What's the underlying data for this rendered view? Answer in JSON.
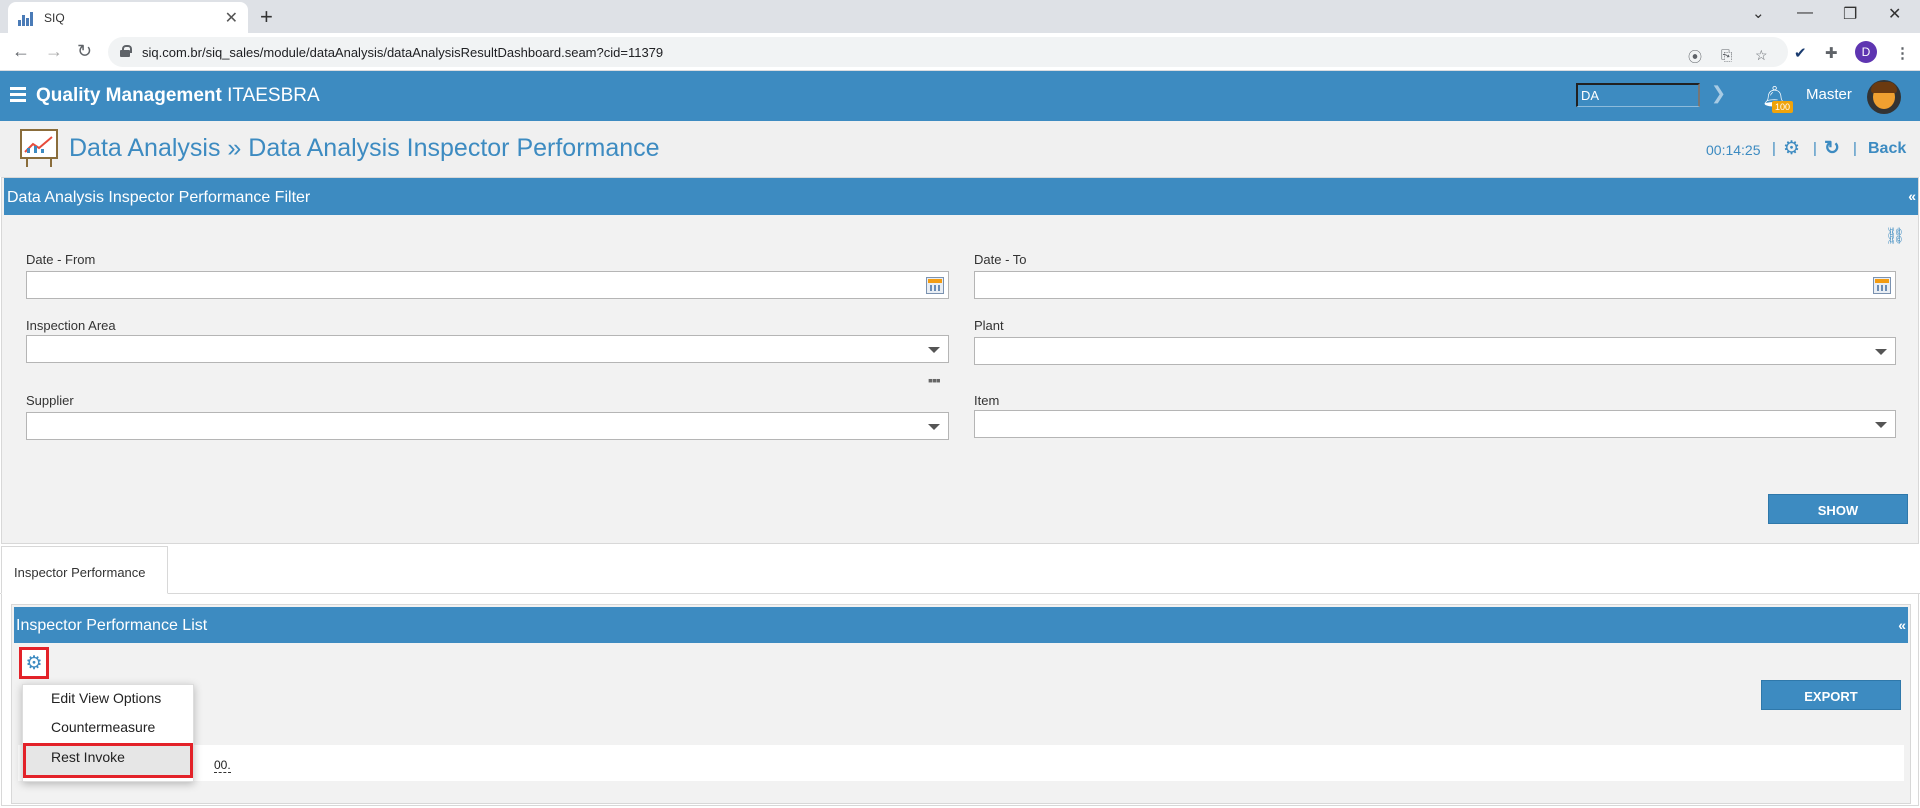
{
  "browser": {
    "tab_title": "SIQ",
    "tab_close": "✕",
    "new_tab": "+",
    "url": "siq.com.br/siq_sales/module/dataAnalysis/dataAnalysisResultDashboard.seam?cid=11379",
    "profile_initial": "D"
  },
  "header": {
    "title_bold": "Quality Management",
    "title_rest": "ITAESBRA",
    "search_value": "DA",
    "notification_count": "100",
    "user_name": "Master",
    "bg_color": "#3d8bc1"
  },
  "page": {
    "breadcrumb": "Data Analysis » Data Analysis Inspector Performance",
    "timer": "00:14:25",
    "separators": [
      "|",
      "|",
      "|"
    ],
    "back_label": "Back"
  },
  "filter": {
    "title": "Data Analysis Inspector Performance Filter",
    "collapse_symbol": "«",
    "fields": {
      "date_from": {
        "label": "Date - From",
        "value": ""
      },
      "date_to": {
        "label": "Date - To",
        "value": ""
      },
      "inspection_area": {
        "label": "Inspection Area",
        "value": ""
      },
      "plant": {
        "label": "Plant",
        "value": ""
      },
      "supplier": {
        "label": "Supplier",
        "value": ""
      },
      "item": {
        "label": "Item",
        "value": ""
      }
    },
    "more_symbol": "▪▪▪",
    "show_button": "SHOW"
  },
  "tabs": [
    {
      "label": "Inspector Performance",
      "active": true
    }
  ],
  "list": {
    "title": "Inspector Performance List",
    "collapse_symbol": "«",
    "export_button": "EXPORT",
    "menu_items": [
      "Edit View Options",
      "Countermeasure",
      "Rest Invoke"
    ],
    "highlighted_item": "Rest Invoke",
    "info_text_visible": "00."
  },
  "icons": {
    "gear": "gear-icon",
    "binoculars": "binoculars-icon",
    "calendar": "calendar-icon",
    "bell": "bell-icon",
    "refresh": "refresh-icon"
  }
}
